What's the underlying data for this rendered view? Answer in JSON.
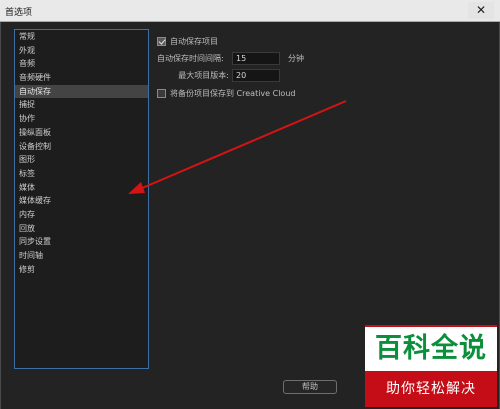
{
  "window": {
    "title": "首选项",
    "close_glyph": "✕"
  },
  "sidebar": {
    "items": [
      {
        "label": "常规",
        "selected": false
      },
      {
        "label": "外观",
        "selected": false
      },
      {
        "label": "音频",
        "selected": false
      },
      {
        "label": "音频硬件",
        "selected": false
      },
      {
        "label": "自动保存",
        "selected": true
      },
      {
        "label": "捕捉",
        "selected": false
      },
      {
        "label": "协作",
        "selected": false
      },
      {
        "label": "操纵面板",
        "selected": false
      },
      {
        "label": "设备控制",
        "selected": false
      },
      {
        "label": "图形",
        "selected": false
      },
      {
        "label": "标签",
        "selected": false
      },
      {
        "label": "媒体",
        "selected": false
      },
      {
        "label": "媒体缓存",
        "selected": false
      },
      {
        "label": "内存",
        "selected": false
      },
      {
        "label": "回放",
        "selected": false
      },
      {
        "label": "同步设置",
        "selected": false
      },
      {
        "label": "时间轴",
        "selected": false
      },
      {
        "label": "修剪",
        "selected": false
      }
    ]
  },
  "autosave": {
    "enable_label": "自动保存项目",
    "enable_checked": true,
    "interval_label": "自动保存时间间隔:",
    "interval_value": "15",
    "interval_unit": "分钟",
    "max_versions_label": "最大项目版本:",
    "max_versions_value": "20",
    "cloud_label": "将备份项目保存到 Creative Cloud",
    "cloud_checked": false
  },
  "footer": {
    "help_label": "帮助"
  },
  "watermark": {
    "top_text": "百科全说",
    "bottom_text": "助你轻松解决"
  },
  "colors": {
    "arrow": "#d41414",
    "selection_border": "#3d6fa6",
    "watermark_red": "#c50d18",
    "watermark_green": "#0b8f3a"
  }
}
